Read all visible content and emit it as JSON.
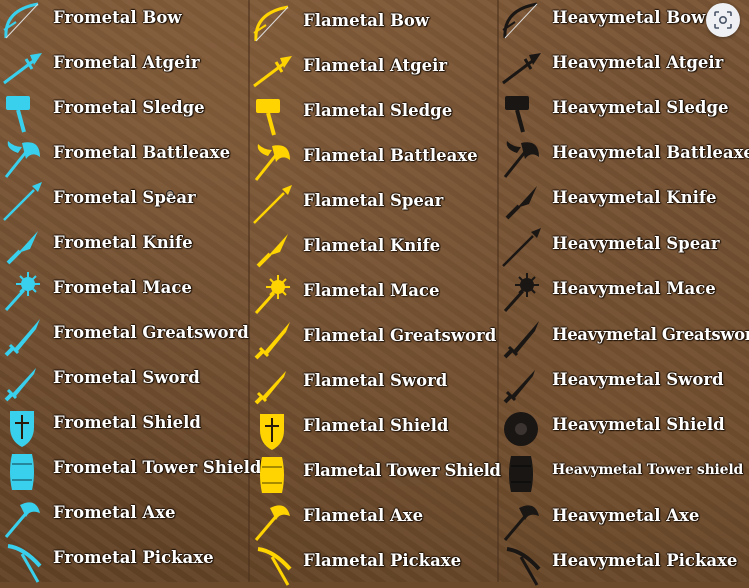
{
  "colors": {
    "frometal": "#39d0ee",
    "flametal": "#ffd400",
    "heavymetal": "#1a1614"
  },
  "columns": [
    {
      "id": "frometal",
      "items": [
        {
          "label": "Frometal Bow",
          "icon": "bow-icon"
        },
        {
          "label": "Frometal Atgeir",
          "icon": "atgeir-icon"
        },
        {
          "label": "Frometal Sledge",
          "icon": "sledge-icon"
        },
        {
          "label": "Frometal Battleaxe",
          "icon": "battleaxe-icon"
        },
        {
          "label": "Frometal Spear",
          "icon": "spear-icon"
        },
        {
          "label": "Frometal Knife",
          "icon": "knife-icon"
        },
        {
          "label": "Frometal Mace",
          "icon": "mace-icon"
        },
        {
          "label": "Frometal Greatsword",
          "icon": "greatsword-icon"
        },
        {
          "label": "Frometal Sword",
          "icon": "sword-icon"
        },
        {
          "label": "Frometal Shield",
          "icon": "shield-icon"
        },
        {
          "label": "Frometal Tower Shield",
          "icon": "tower-shield-icon"
        },
        {
          "label": "Frometal Axe",
          "icon": "axe-icon"
        },
        {
          "label": "Frometal Pickaxe",
          "icon": "pickaxe-icon"
        }
      ]
    },
    {
      "id": "flametal",
      "items": [
        {
          "label": "Flametal Bow",
          "icon": "bow-icon"
        },
        {
          "label": "Flametal Atgeir",
          "icon": "atgeir-icon"
        },
        {
          "label": "Flametal Sledge",
          "icon": "sledge-icon"
        },
        {
          "label": "Flametal Battleaxe",
          "icon": "battleaxe-icon"
        },
        {
          "label": "Flametal Spear",
          "icon": "spear-icon"
        },
        {
          "label": "Flametal Knife",
          "icon": "knife-icon"
        },
        {
          "label": "Flametal Mace",
          "icon": "mace-icon"
        },
        {
          "label": "Flametal Greatsword",
          "icon": "greatsword-icon"
        },
        {
          "label": "Flametal Sword",
          "icon": "sword-icon"
        },
        {
          "label": "Flametal Shield",
          "icon": "shield-icon"
        },
        {
          "label": "Flametal Tower Shield",
          "icon": "tower-shield-icon"
        },
        {
          "label": "Flametal Axe",
          "icon": "axe-icon"
        },
        {
          "label": "Flametal Pickaxe",
          "icon": "pickaxe-icon"
        }
      ]
    },
    {
      "id": "heavymetal",
      "items": [
        {
          "label": "Heavymetal Bow",
          "icon": "bow-icon"
        },
        {
          "label": "Heavymetal Atgeir",
          "icon": "atgeir-icon"
        },
        {
          "label": "Heavymetal Sledge",
          "icon": "sledge-icon"
        },
        {
          "label": "Heavymetal Battleaxe",
          "icon": "battleaxe-icon"
        },
        {
          "label": "Heavymetal Knife",
          "icon": "knife-icon"
        },
        {
          "label": "Heavymetal Spear",
          "icon": "spear-icon"
        },
        {
          "label": "Heavymetal Mace",
          "icon": "mace-icon"
        },
        {
          "label": "Heavymetal Greatsword",
          "icon": "greatsword-icon"
        },
        {
          "label": "Heavymetal Sword",
          "icon": "sword-icon"
        },
        {
          "label": "Heavymetal Shield",
          "icon": "round-shield-icon"
        },
        {
          "label": "Heavymetal Tower shield",
          "icon": "tower-shield-icon"
        },
        {
          "label": "Heavymetal Axe",
          "icon": "axe-icon"
        },
        {
          "label": "Heavymetal Pickaxe",
          "icon": "pickaxe-icon"
        }
      ]
    }
  ],
  "toolbar": {
    "lens_icon": "visual-search-icon"
  }
}
